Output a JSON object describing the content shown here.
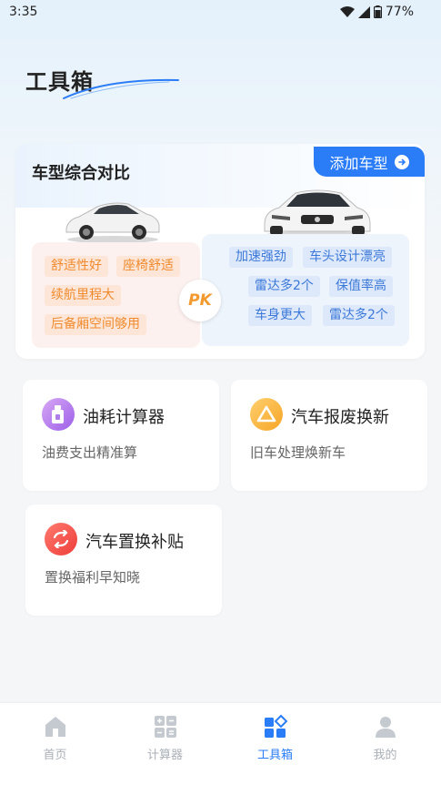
{
  "status": {
    "time": "3:35",
    "battery": "77%"
  },
  "header": {
    "title": "工具箱"
  },
  "compare": {
    "title": "车型综合对比",
    "add_button": "添加车型",
    "pk_label": "PK",
    "left_tags": [
      "舒适性好",
      "座椅舒适",
      "续航里程大",
      "后备厢空间够用"
    ],
    "right_tags": [
      "加速强劲",
      "车头设计漂亮",
      "雷达多2个",
      "保值率高",
      "车身更大",
      "雷达多2个"
    ]
  },
  "tools": [
    {
      "title": "油耗计算器",
      "subtitle": "油费支出精准算",
      "icon": "fuel-can-icon"
    },
    {
      "title": "汽车报废换新",
      "subtitle": "旧车处理焕新车",
      "icon": "recycle-triangle-icon"
    },
    {
      "title": "汽车置换补贴",
      "subtitle": "置换福利早知晓",
      "icon": "exchange-arrows-icon"
    }
  ],
  "tabs": [
    {
      "label": "首页",
      "icon": "home-icon"
    },
    {
      "label": "计算器",
      "icon": "calculator-icon"
    },
    {
      "label": "工具箱",
      "icon": "toolbox-icon",
      "active": true
    },
    {
      "label": "我的",
      "icon": "person-icon"
    }
  ],
  "colors": {
    "accent": "#2a7cf7",
    "tag_orange": "#f08a2c",
    "tag_blue": "#3b78d8"
  }
}
